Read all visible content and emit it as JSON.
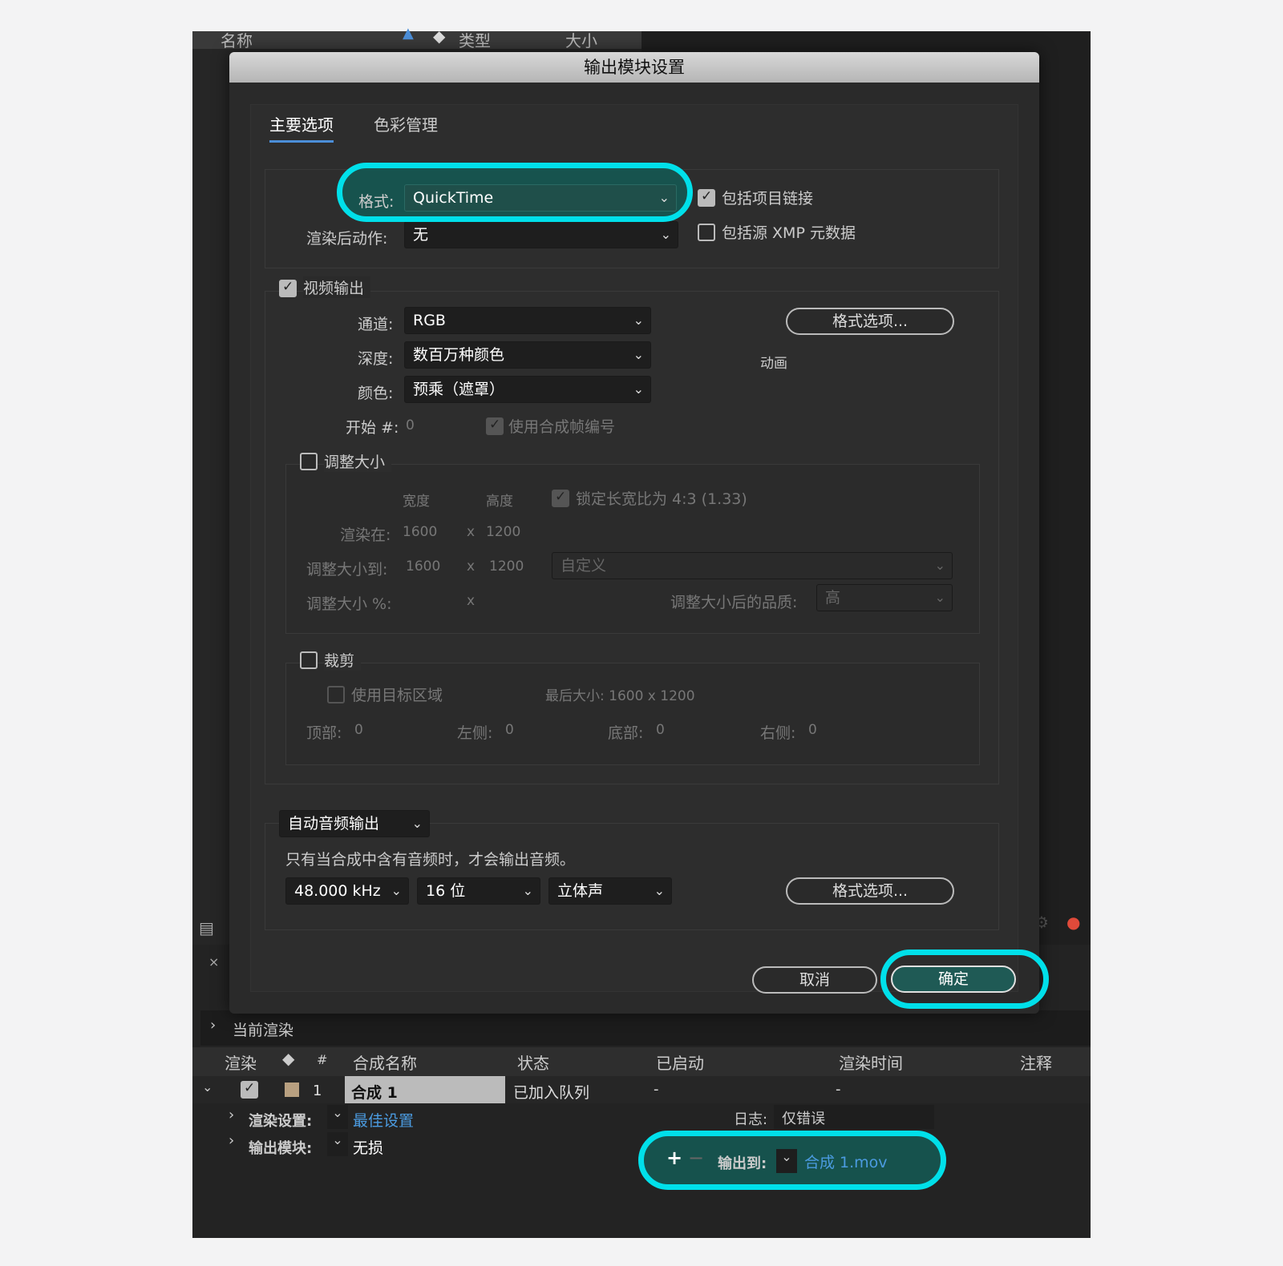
{
  "project_header": {
    "col_name": "名称",
    "col_type": "类型",
    "col_size": "大小"
  },
  "dialog": {
    "title": "输出模块设置",
    "tabs": [
      {
        "label": "主要选项"
      },
      {
        "label": "色彩管理"
      }
    ],
    "format_label": "格式:",
    "format_value": "QuickTime",
    "post_render_label": "渲染后动作:",
    "post_render_value": "无",
    "include_project_link": "包括项目链接",
    "include_xmp": "包括源 XMP 元数据",
    "video_output": "视频输出",
    "channel_label": "通道:",
    "channel_value": "RGB",
    "depth_label": "深度:",
    "depth_value": "数百万种颜色",
    "color_label": "颜色:",
    "color_value": "预乘（遮罩）",
    "start_label": "开始 #:",
    "start_value": "0",
    "use_comp_frame": "使用合成帧编号",
    "format_options": "格式选项...",
    "codec_name": "动画",
    "resize": {
      "title": "调整大小",
      "width_label": "宽度",
      "height_label": "高度",
      "lock_ratio": "锁定长宽比为 4:3 (1.33)",
      "render_at_label": "渲染在:",
      "render_w": "1600",
      "x": "x",
      "render_h": "1200",
      "resize_to_label": "调整大小到:",
      "resize_w": "1600",
      "resize_h": "1200",
      "preset": "自定义",
      "resize_pct_label": "调整大小 %:",
      "quality_label": "调整大小后的品质:",
      "quality_value": "高"
    },
    "crop": {
      "title": "裁剪",
      "use_roi": "使用目标区域",
      "final_size": "最后大小: 1600 x 1200",
      "top_label": "顶部:",
      "top_value": "0",
      "left_label": "左侧:",
      "left_value": "0",
      "bottom_label": "底部:",
      "bottom_value": "0",
      "right_label": "右侧:",
      "right_value": "0"
    },
    "audio": {
      "mode": "自动音频输出",
      "note": "只有当合成中含有音频时，才会输出音频。",
      "rate": "48.000 kHz",
      "bits": "16 位",
      "channels": "立体声",
      "format_options": "格式选项..."
    },
    "cancel": "取消",
    "ok": "确定"
  },
  "render_queue": {
    "current_render": "当前渲染",
    "headers": {
      "render": "渲染",
      "hash": "#",
      "comp_name": "合成名称",
      "status": "状态",
      "started": "已启动",
      "render_time": "渲染时间",
      "comment": "注释"
    },
    "row": {
      "index": "1",
      "comp": "合成 1",
      "status": "已加入队列",
      "started": "-",
      "render_time": "-"
    },
    "render_settings_label": "渲染设置:",
    "render_settings_value": "最佳设置",
    "output_module_label": "输出模块:",
    "output_module_value": "无损",
    "log_label": "日志:",
    "log_value": "仅错误",
    "output_to_label": "输出到:",
    "output_to_value": "合成 1.mov"
  },
  "colors": {
    "accent_cyan": "#00e0ea",
    "link_blue": "#4b9be0",
    "primary_teal": "#1f5a55"
  }
}
